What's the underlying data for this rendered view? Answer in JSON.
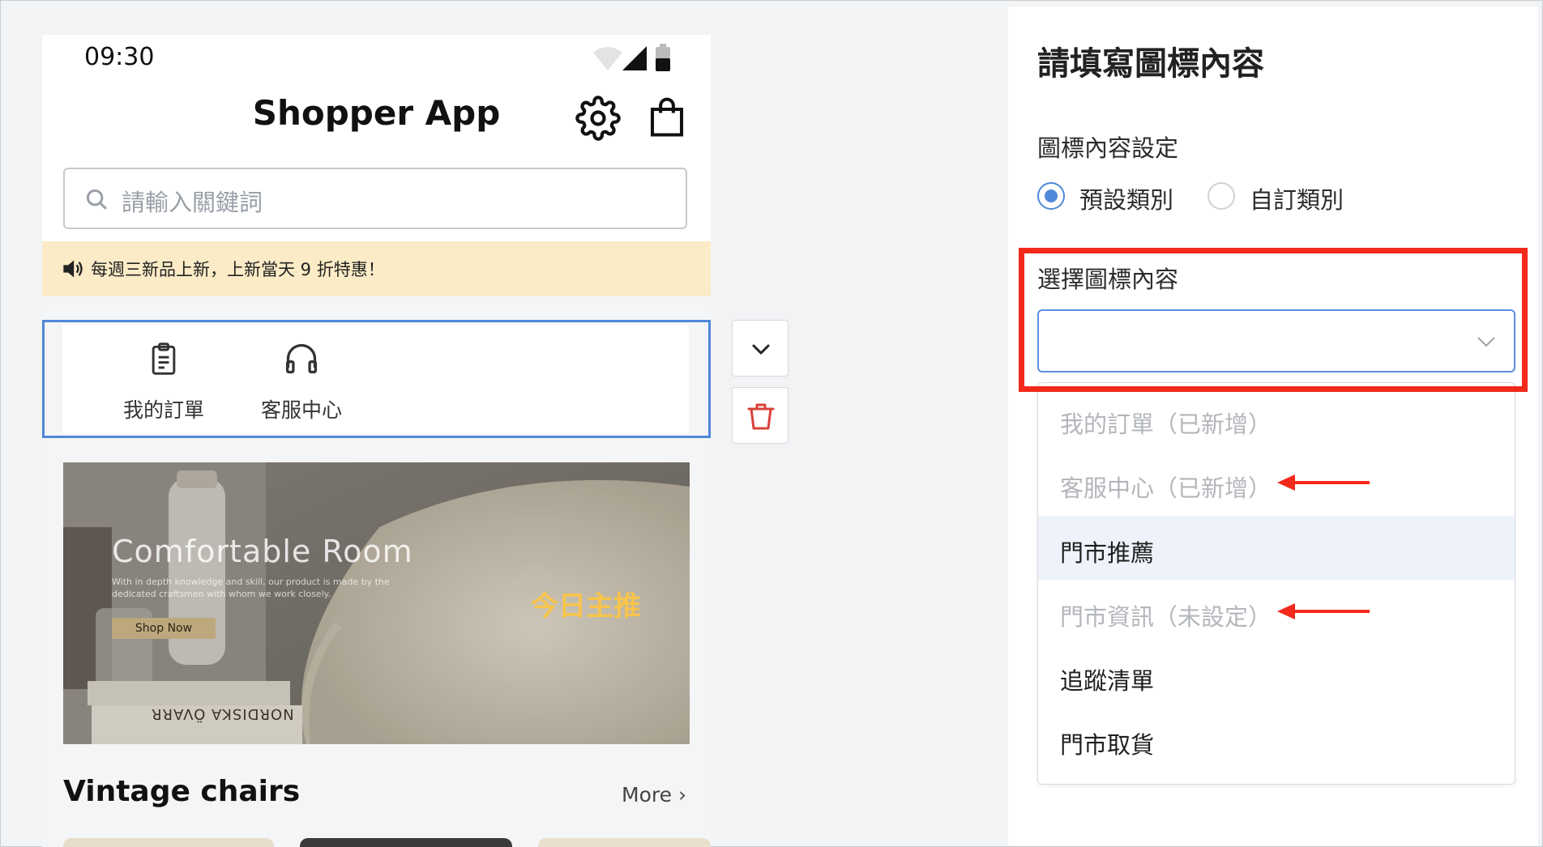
{
  "phone": {
    "status_time": "09:30",
    "app_title": "Shopper App",
    "search_placeholder": "請輸入關鍵詞",
    "notice_text": "每週三新品上新，上新當天 9 折特惠！",
    "icon_items": [
      {
        "label": "我的訂單",
        "icon": "clipboard-icon"
      },
      {
        "label": "客服中心",
        "icon": "headphones-icon"
      }
    ],
    "banner": {
      "title": "Comfortable Room",
      "subtitle": "With in depth knowledge and skill, our product is made by the dedicated craftsmen with whom we work closely.",
      "button": "Shop Now",
      "book_text": "NORDISKA ÖVARR",
      "badge": "今日主推"
    },
    "section_title": "Vintage chairs",
    "more_label": "More"
  },
  "actions": {
    "expand_icon": "chevron-down-icon",
    "delete_icon": "trash-icon"
  },
  "panel": {
    "title": "請填寫圖標內容",
    "group_label": "圖標內容設定",
    "radio_options": [
      {
        "label": "預設類別",
        "selected": true
      },
      {
        "label": "自訂類別",
        "selected": false
      }
    ],
    "select_label": "選擇圖標內容",
    "select_value": "",
    "dropdown_items": [
      {
        "label": "我的訂單（已新增）",
        "disabled": true
      },
      {
        "label": "客服中心（已新增）",
        "disabled": true
      },
      {
        "label": "門市推薦",
        "disabled": false,
        "hovered": true
      },
      {
        "label": "門市資訊（未設定）",
        "disabled": true
      },
      {
        "label": "追蹤清單",
        "disabled": false
      },
      {
        "label": "門市取貨",
        "disabled": false
      }
    ]
  },
  "colors": {
    "accent_blue": "#4f88d8",
    "highlight_red": "#f3291c",
    "notice_bg": "#fbebc6",
    "badge_yellow": "#f8c44b",
    "delete_red": "#d9413a"
  }
}
